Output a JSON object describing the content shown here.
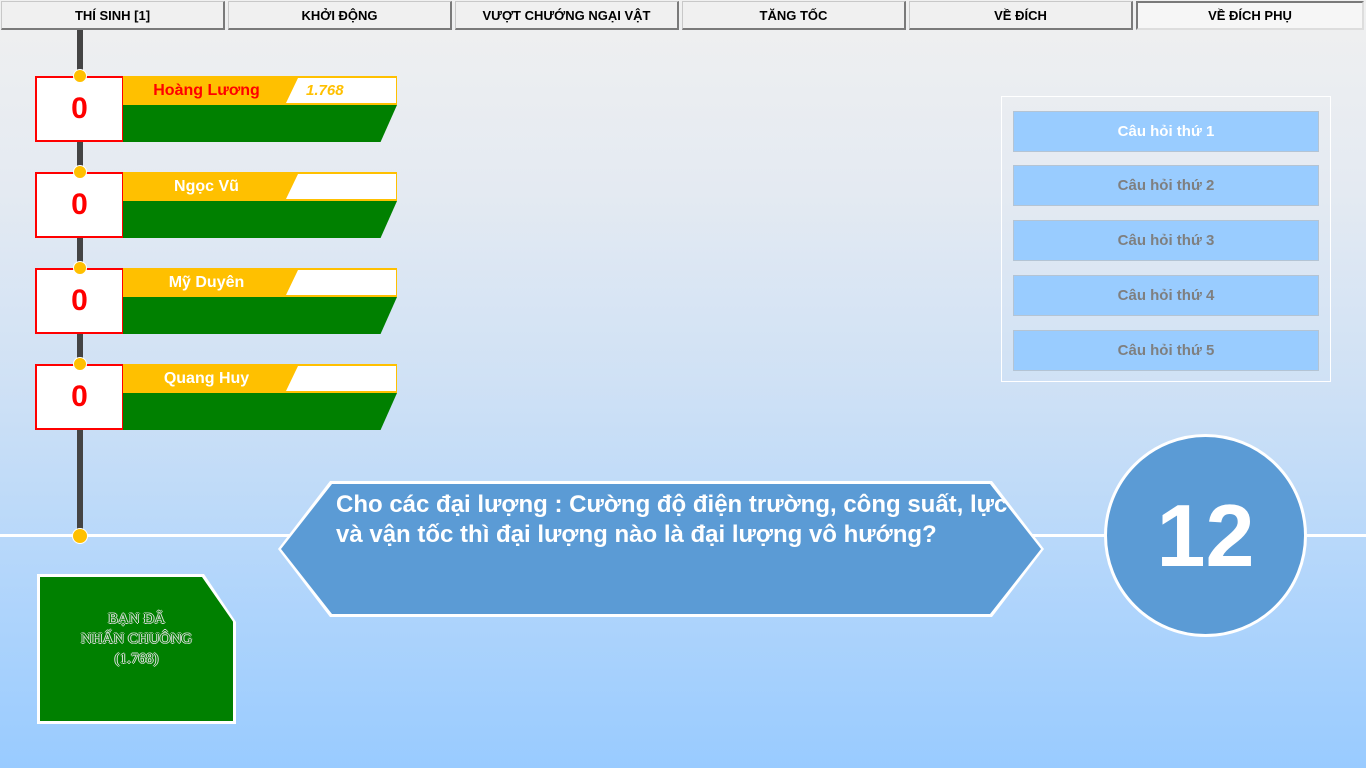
{
  "tabs": [
    {
      "label": "THÍ SINH [1]"
    },
    {
      "label": "KHỞI ĐỘNG"
    },
    {
      "label": "VƯỢT CHƯỚNG NGẠI VẬT"
    },
    {
      "label": "TĂNG TỐC"
    },
    {
      "label": "VỀ ĐÍCH"
    },
    {
      "label": "VỀ ĐÍCH PHỤ",
      "active": true
    }
  ],
  "contestants": [
    {
      "name": "Hoàng Lương",
      "score": "0",
      "time": "1.768",
      "name_color": "#ff0000"
    },
    {
      "name": "Ngọc Vũ",
      "score": "0",
      "time": ""
    },
    {
      "name": "Mỹ Duyên",
      "score": "0",
      "time": ""
    },
    {
      "name": "Quang Huy",
      "score": "0",
      "time": ""
    }
  ],
  "questions": [
    {
      "label": "Câu hỏi thứ 1",
      "active": true
    },
    {
      "label": "Câu hỏi thứ 2"
    },
    {
      "label": "Câu hỏi thứ 3"
    },
    {
      "label": "Câu hỏi thứ 4"
    },
    {
      "label": "Câu hỏi thứ 5"
    }
  ],
  "question_text": "Cho các đại lượng : Cường độ điện trường, công suất, lực và vận tốc thì đại lượng nào là đại lượng vô hướng?",
  "timer": "12",
  "bell": {
    "line1": "BẠN ĐÃ",
    "line2": "NHẤN CHUÔNG",
    "line3": "(1.768)"
  },
  "colors": {
    "accent_yellow": "#ffc000",
    "green": "#008000",
    "blue": "#5b9bd5",
    "question_button": "#99ccff",
    "score_red": "#ff0000"
  }
}
